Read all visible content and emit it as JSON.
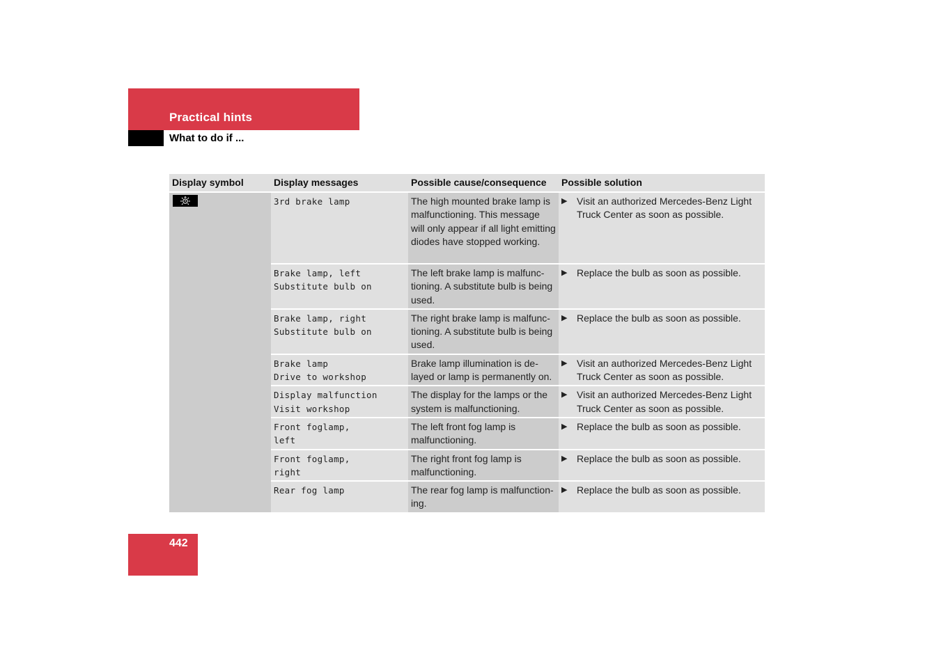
{
  "header": {
    "section": "Practical hints",
    "subsection": "What to do if ..."
  },
  "page_number": "442",
  "colors": {
    "accent_red": "#d93a48",
    "dark_cell": "#cccccc",
    "light_cell": "#e0e0e0"
  },
  "table": {
    "columns": [
      "Display symbol",
      "Display messages",
      "Possible cause/consequence",
      "Possible solution"
    ],
    "symbol_icon": "brake-lamp-warning-icon",
    "rows": [
      {
        "message": [
          "3rd brake lamp"
        ],
        "cause": "The high mounted brake lamp is malfunctioning. This message will only appear if all light emitting diodes have stopped working.",
        "solution": "Visit an authorized Mercedes-Benz Light Truck Center as soon as possible."
      },
      {
        "message": [
          "Brake lamp, left",
          "Substitute bulb on"
        ],
        "cause": "The left brake lamp is malfunc-tioning. A substitute bulb is being used.",
        "solution": "Replace the bulb as soon as possible."
      },
      {
        "message": [
          "Brake lamp, right",
          "Substitute bulb on"
        ],
        "cause": "The right brake lamp is malfunc-tioning. A substitute bulb is being used.",
        "solution": "Replace the bulb as soon as possible."
      },
      {
        "message": [
          "Brake lamp",
          "Drive to workshop"
        ],
        "cause": "Brake lamp illumination is de-layed or lamp is permanently on.",
        "solution": "Visit an authorized Mercedes-Benz Light Truck Center as soon as possible."
      },
      {
        "message": [
          "Display malfunction",
          "Visit workshop"
        ],
        "cause": "The display for the lamps or the system is malfunctioning.",
        "solution": "Visit an authorized Mercedes-Benz Light Truck Center as soon as possible."
      },
      {
        "message": [
          "Front foglamp,",
          "left"
        ],
        "cause": "The left front fog lamp is malfunctioning.",
        "solution": "Replace the bulb as soon as possible."
      },
      {
        "message": [
          "Front foglamp,",
          "right"
        ],
        "cause": "The right front fog lamp is malfunctioning.",
        "solution": "Replace the bulb as soon as possible."
      },
      {
        "message": [
          "Rear fog lamp"
        ],
        "cause": "The rear fog lamp is malfunction-ing.",
        "solution": "Replace the bulb as soon as possible."
      }
    ]
  }
}
